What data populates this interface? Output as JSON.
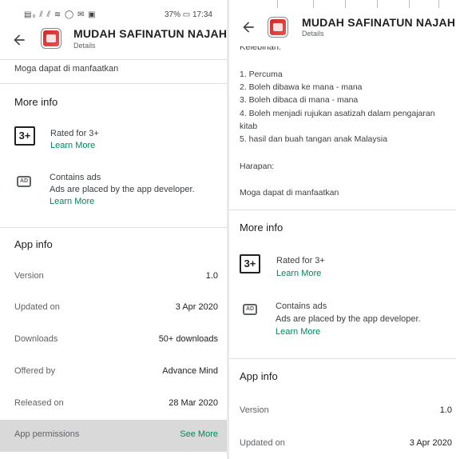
{
  "status": {
    "left_icons": "▤₀ ⫽ ⫽ ≋ ◯ ✉ ▣",
    "right": "37% ▭ 17:34"
  },
  "app": {
    "title": "MUDAH SAFINATUN NAJAH",
    "subtitle": "Details"
  },
  "left": {
    "top_text": "Moga dapat di manfaatkan",
    "more_info_heading": "More info",
    "rating_badge": "3+",
    "rated_for": "Rated for 3+",
    "learn_more_1": "Learn More",
    "ads_badge": "AD",
    "contains_ads": "Contains ads",
    "ads_desc": "Ads are placed by the app developer.",
    "learn_more_2": "Learn More",
    "app_info_heading": "App info",
    "rows": [
      {
        "key": "Version",
        "value": "1.0"
      },
      {
        "key": "Updated on",
        "value": "3 Apr 2020"
      },
      {
        "key": "Downloads",
        "value": "50+ downloads"
      },
      {
        "key": "Offered by",
        "value": "Advance Mind"
      },
      {
        "key": "Released on",
        "value": "28 Mar 2020"
      },
      {
        "key": "App permissions",
        "value": "See More"
      }
    ]
  },
  "right": {
    "cut_heading": "Kelebihan:",
    "lines": [
      "1. Percuma",
      "2. Boleh dibawa ke mana - mana",
      "3. Boleh dibaca di mana - mana",
      "4. Boleh menjadi rujukan asatizah dalam pengajaran",
      "kitab",
      "5. hasil dan buah tangan anak Malaysia"
    ],
    "harapan": "Harapan:",
    "harapan_text": "Moga dapat di manfaatkan",
    "more_info_heading": "More info",
    "rating_badge": "3+",
    "rated_for": "Rated for 3+",
    "learn_more_1": "Learn More",
    "ads_badge": "AD",
    "contains_ads": "Contains ads",
    "ads_desc": "Ads are placed by the app developer.",
    "learn_more_2": "Learn More",
    "app_info_heading": "App info",
    "rows": [
      {
        "key": "Version",
        "value": "1.0"
      },
      {
        "key": "Updated on",
        "value": "3 Apr 2020"
      }
    ]
  }
}
